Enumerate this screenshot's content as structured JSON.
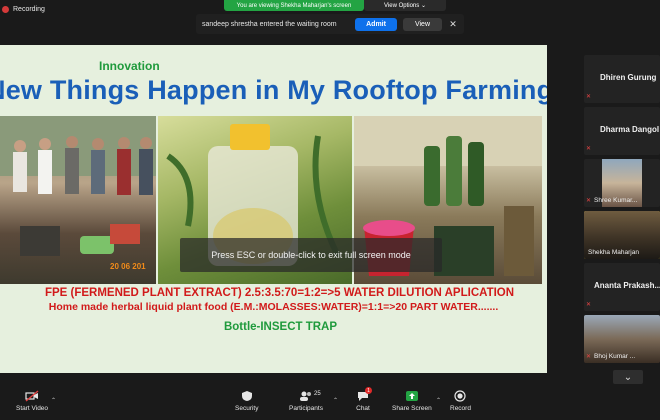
{
  "recording": {
    "label": "Recording"
  },
  "banner": {
    "viewing": "You are viewing Shekha Maharjan's screen",
    "view_options": "View Options ⌄"
  },
  "waiting_room": {
    "message": "sandeep shrestha entered the waiting room",
    "admit_label": "Admit",
    "view_label": "View",
    "close_icon": "close-icon"
  },
  "slide": {
    "heading": "Innovation",
    "title": "New Things Happen in My Rooftop Farming",
    "line1": "FPE (FERMENED PLANT EXTRACT)  2.5:3.5:70=1:2=>5  WATER DILUTION APLICATION",
    "line2": "Home made herbal liquid plant food (E.M.:MOLASSES:WATER)=1:1=>20 PART WATER.......",
    "line3": "Bottle-INSECT TRAP",
    "photo_date": "20 06 201"
  },
  "fullscreen_hint": "Press ESC or double-click to exit full screen mode",
  "participants": [
    {
      "name": "Dhiren Gurung",
      "video": false,
      "muted": true
    },
    {
      "name": "Dharma Dangol",
      "video": false,
      "muted": true
    },
    {
      "name": "Shree Kumar...",
      "video": true,
      "muted": true
    },
    {
      "name": "Shekha Maharjan",
      "video": true,
      "muted": false,
      "active": true
    },
    {
      "name": "Ananta  Prakash...",
      "video": false,
      "muted": true
    },
    {
      "name": "Bhoj Kumar ...",
      "video": true,
      "muted": true
    }
  ],
  "toolbar": {
    "start_video": "Start Video",
    "security": "Security",
    "participants": "Participants",
    "participants_count": "25",
    "chat": "Chat",
    "chat_badge": "1",
    "share_screen": "Share Screen",
    "record": "Record"
  },
  "colors": {
    "admit": "#0e71eb",
    "viewing_banner": "#23a443",
    "share_green": "#23a443",
    "slide_bg": "#e6f0de",
    "title_blue": "#1a5fb8",
    "text_red": "#d11a1a",
    "text_green": "#1f9a3c"
  }
}
